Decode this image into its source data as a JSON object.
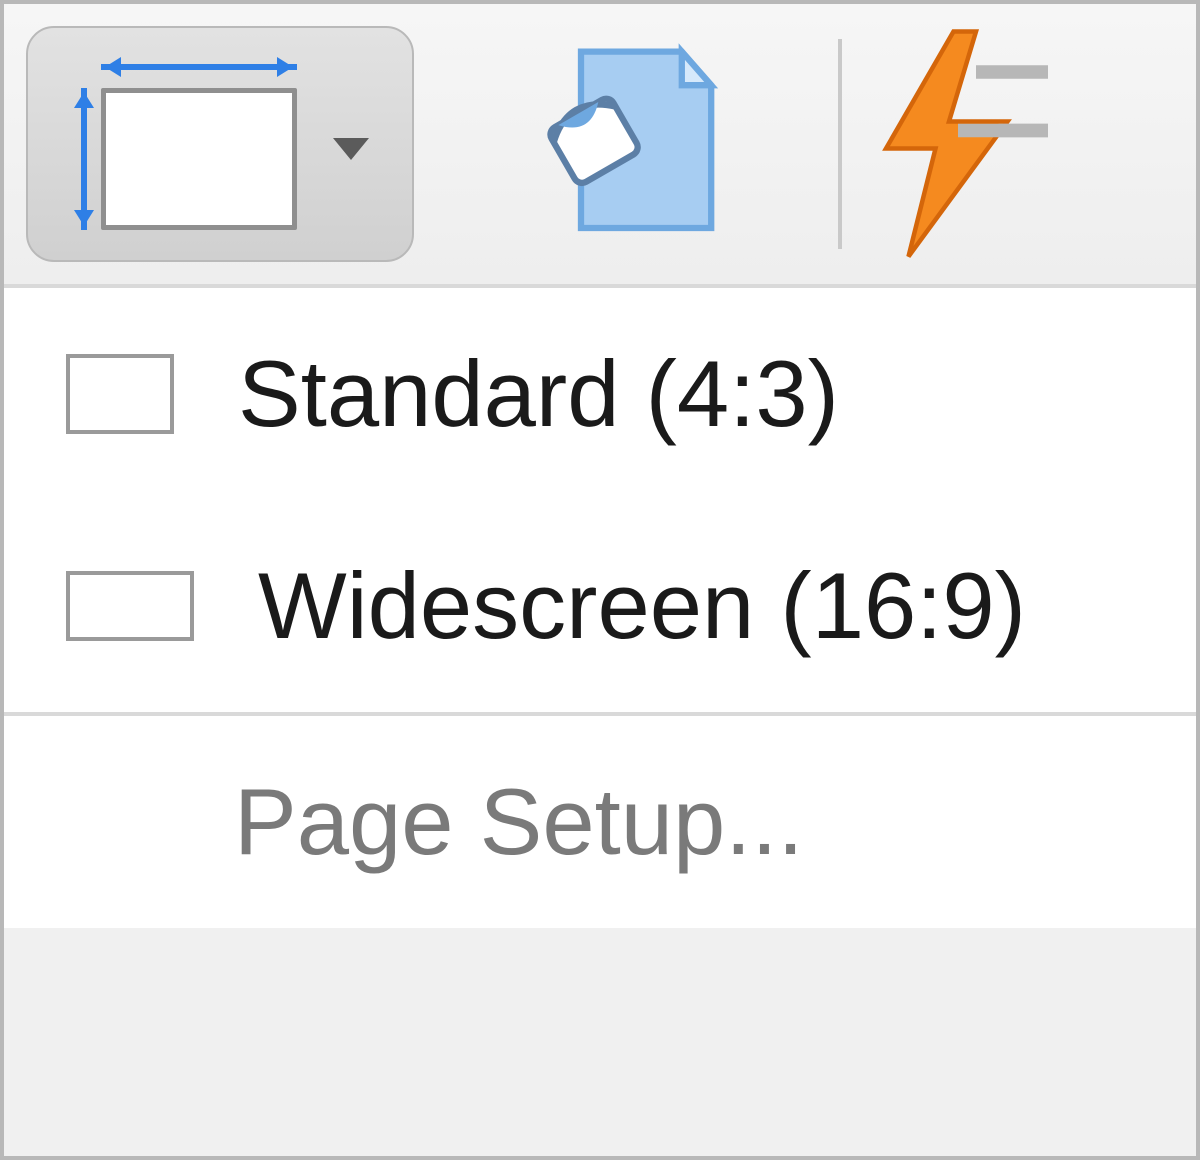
{
  "toolbar": {
    "slide_size_button": "Slide Size",
    "format_background_button": "Format Background"
  },
  "menu": {
    "standard_label": "Standard (4:3)",
    "widescreen_label": "Widescreen (16:9)",
    "page_setup_label": "Page Setup..."
  }
}
